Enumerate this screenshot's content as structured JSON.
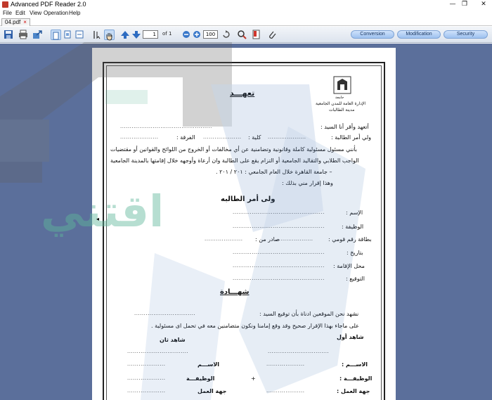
{
  "window": {
    "title": "Advanced PDF Reader 2.0",
    "minimize": "—",
    "maximize": "❐",
    "close": "✕"
  },
  "menu": [
    "File",
    "Edit",
    "View",
    "Operation",
    "Help"
  ],
  "tab": {
    "label": "04.pdf",
    "close": "×"
  },
  "toolbar": {
    "page_current": "1",
    "page_total": "of 1",
    "zoom": "100",
    "buttons": [
      "Conversion",
      "Modification",
      "Security"
    ]
  },
  "document": {
    "university": "جامعة",
    "admin_line1": "الإدارة العامة للمدن الجامعية",
    "admin_line2": "مدينة الطالبات",
    "title": "تعهـــد",
    "line1": "أتعهد وأقر أنا السيد :",
    "line2_a": "ولي أمر الطالبة :",
    "line2_b": "كلية :",
    "line2_c": "الفرقة :",
    "para1": "بأنني مسئول مسئولية كاملة وقانونية وتضامنية عن أي مخالفات أو الخروج من اللوائح والقوانين أو مقتضيات",
    "para2": "الواجب الطلابي والتقاليد الجامعية أو التزام يقع على الطالبة وان أرعاة وأوجهه خلال إقامتها بالمدينة الجامعية",
    "para3": "– جامعة القاهرة خلال العام الجامعي : ٢٠١ / ٢٠١ .",
    "para4": "وهذا إقرار مني بذلك :",
    "guardian_heading": "ولى أمر الطالبه",
    "f_name": "الإسم :",
    "f_job": "الوظيفة :",
    "f_id": "بطاقة رقم قومي :",
    "f_issued": "صادر من :",
    "f_date": "بتاريخ :",
    "f_residence": "محل الإقامة :",
    "f_signature": "التوقيع :",
    "testimony_heading": "شهـــادة",
    "test1": "نشهد نحن الموقعين ادناة بأن توقيع السيد :",
    "test2": "على ماجاء بهذا الإقرار صحيح وقد وقع إمامنا ونكون متضامنين معه في تحمل اى مسئولية .",
    "witness1": "شاهد أول",
    "witness2": "شاهد ثان",
    "w_name": "الاســـم :",
    "w_job": "الوظيفـــة :",
    "w_work": "جهة العمل :",
    "w_name2": "الاســـم",
    "w_job2": "الوظيفـــة",
    "w_work2": "جهة العمل",
    "dots_long": "................................................",
    "dots_med": "................................",
    "dots_short": "....................",
    "plus": "+"
  },
  "watermark": {
    "text": "اقتني",
    "color": "#5fb89a"
  }
}
